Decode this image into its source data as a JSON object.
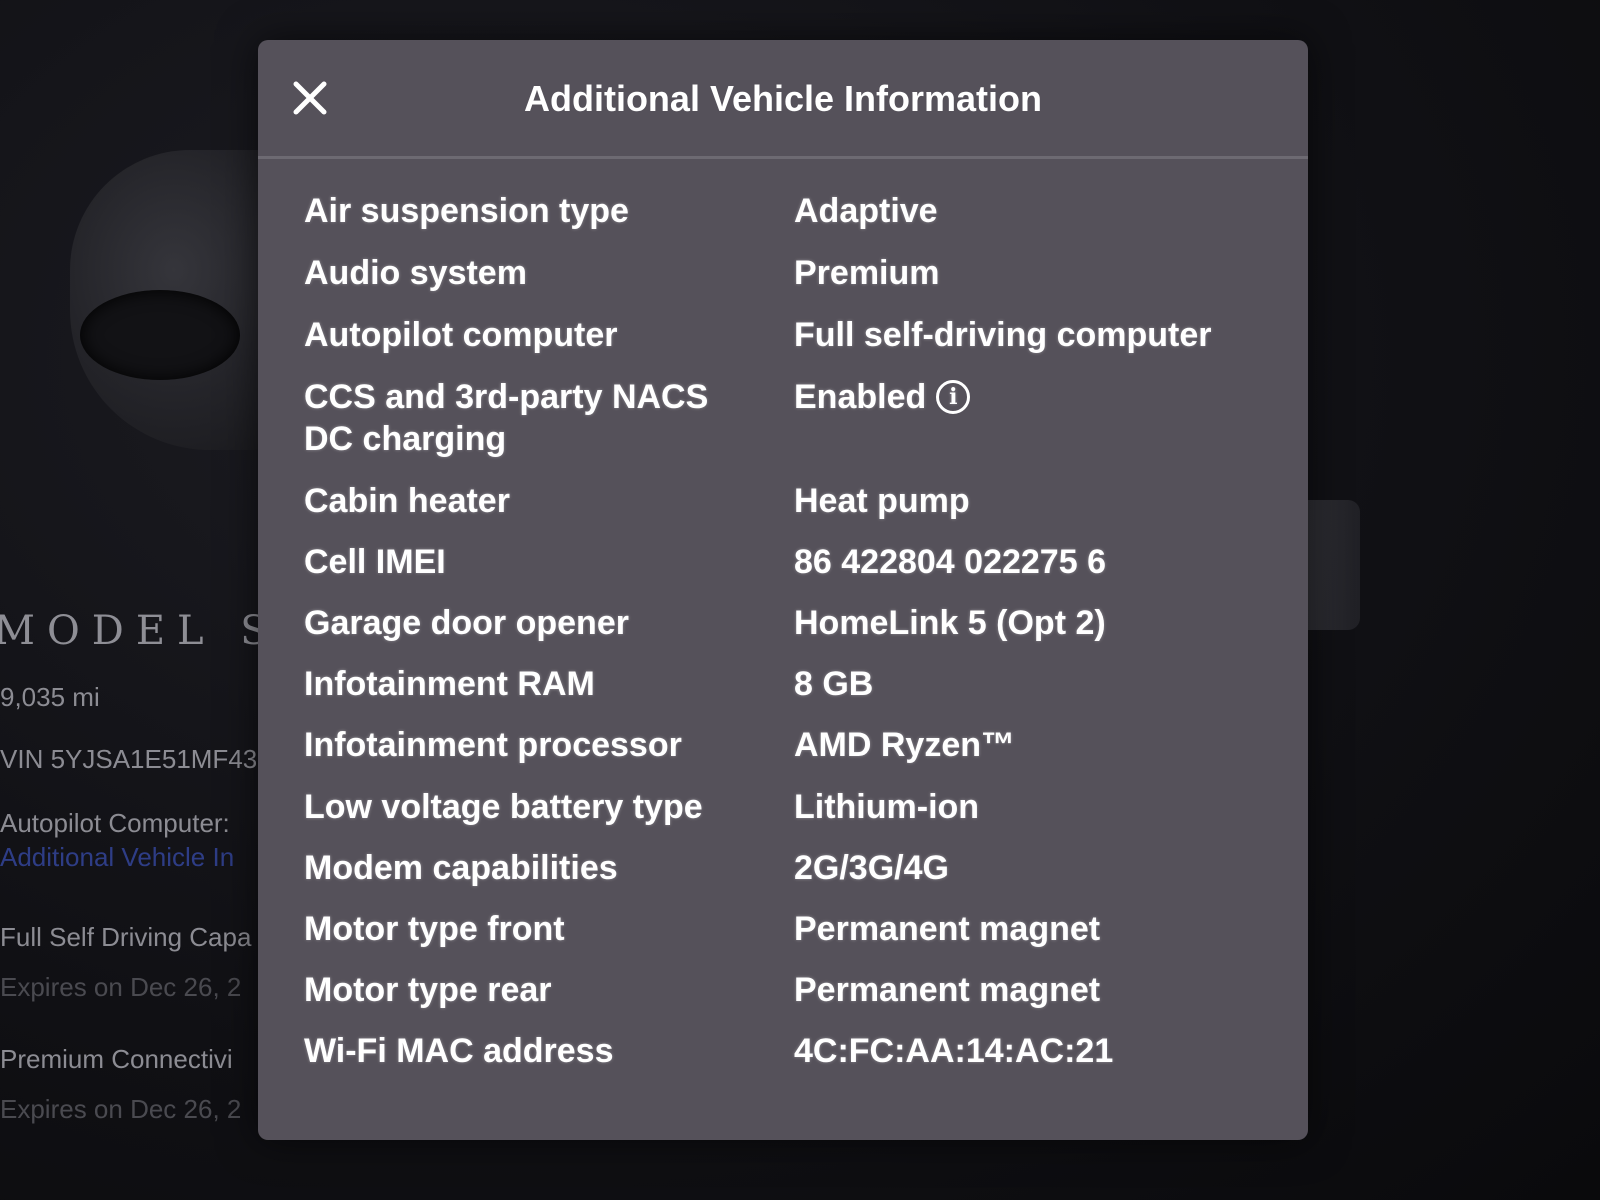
{
  "background": {
    "model_text": "MODEL S",
    "odometer": "9,035 mi",
    "vin": "VIN 5YJSA1E51MF43",
    "autopilot_label": "Autopilot Computer:",
    "autopilot_link": "Additional Vehicle In",
    "fsd_title": "Full Self Driving Capa",
    "fsd_expiry": "Expires on Dec 26, 2",
    "premium_title": "Premium Connectivi",
    "premium_expiry": "Expires on Dec 26, 2"
  },
  "modal": {
    "title": "Additional Vehicle Information",
    "close_icon": "close-icon",
    "rows": [
      {
        "label": "Air suspension type",
        "value": "Adaptive"
      },
      {
        "label": "Audio system",
        "value": "Premium"
      },
      {
        "label": "Autopilot computer",
        "value": "Full self-driving computer"
      },
      {
        "label": "CCS and 3rd-party NACS DC charging",
        "value": "Enabled",
        "icon": "info-icon"
      },
      {
        "label": "Cabin heater",
        "value": "Heat pump"
      },
      {
        "label": "Cell IMEI",
        "value": "86 422804 022275 6"
      },
      {
        "label": "Garage door opener",
        "value": "HomeLink 5 (Opt 2)"
      },
      {
        "label": "Infotainment RAM",
        "value": "8 GB"
      },
      {
        "label": "Infotainment processor",
        "value": "AMD Ryzen™"
      },
      {
        "label": "Low voltage battery type",
        "value": "Lithium-ion"
      },
      {
        "label": "Modem capabilities",
        "value": "2G/3G/4G"
      },
      {
        "label": "Motor type front",
        "value": "Permanent magnet"
      },
      {
        "label": "Motor type rear",
        "value": "Permanent magnet"
      },
      {
        "label": "Wi-Fi MAC address",
        "value": "4C:FC:AA:14:AC:21"
      }
    ]
  }
}
